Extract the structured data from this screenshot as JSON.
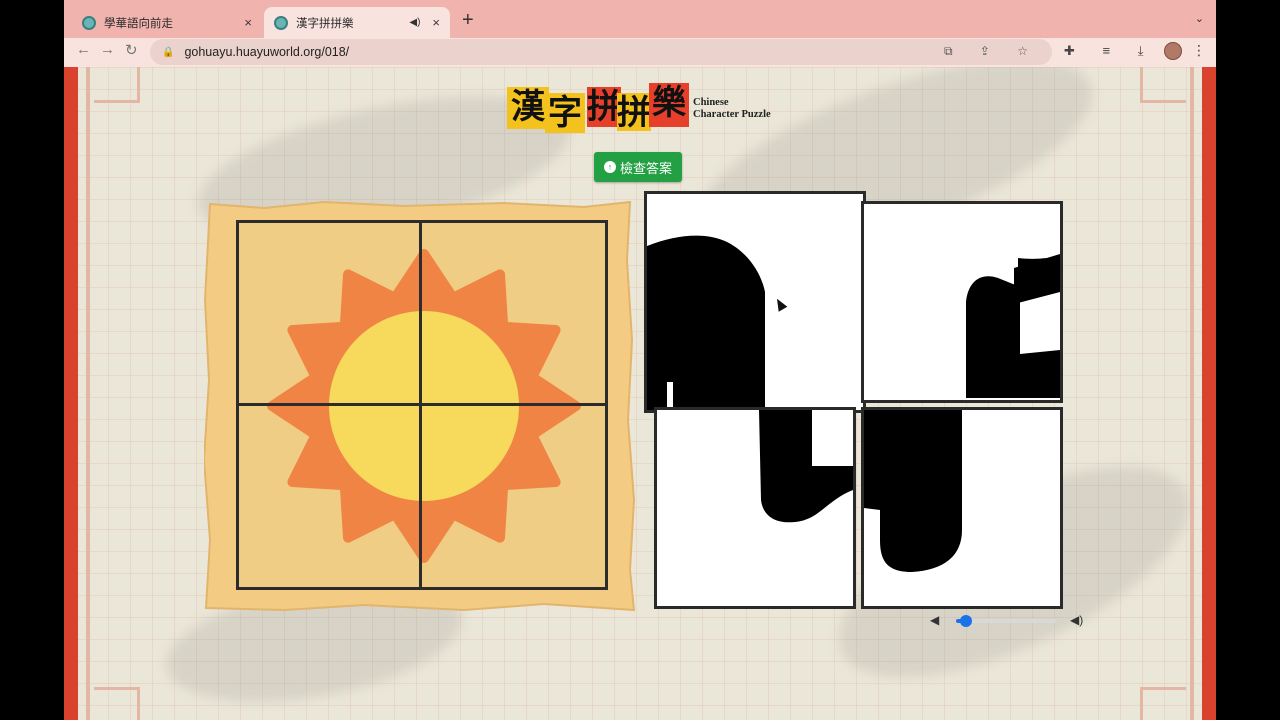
{
  "browser": {
    "tabs": [
      {
        "title": "學華語向前走",
        "active": false,
        "close": "×"
      },
      {
        "title": "漢字拼拼樂",
        "active": true,
        "close": "×",
        "speaker": "◀)"
      }
    ],
    "new_tab": "+",
    "tab_search": "⌄",
    "nav": {
      "back": "←",
      "forward": "→",
      "reload": "↻"
    },
    "url": "gohuayu.huayuworld.org/018/",
    "lock_icon": "🔒",
    "omni_icons": "⧉ ⇪ ☆",
    "ext_icons": "✚ ≡ ⤓ ▯",
    "menu": "⋮"
  },
  "page": {
    "logo": {
      "chars": [
        "漢",
        "字",
        "拼",
        "拼",
        "樂"
      ],
      "colors": [
        "#f4c21c",
        "#f4c21c",
        "#e7402a",
        "#f4c21c",
        "#e7402a"
      ],
      "subtitle_line1": "Chinese",
      "subtitle_line2": "Character Puzzle"
    },
    "check_button": {
      "icon": "↑",
      "label": "檢查答案",
      "color": "#23a043"
    },
    "picture": {
      "subject": "sun",
      "sun_core": "#f7d95c",
      "sun_rays": "#ef8445",
      "parchment": "#f4cb83",
      "cells_fill": "#f0cd84"
    },
    "puzzle_tiles": [
      {
        "id": "top-left"
      },
      {
        "id": "top-right"
      },
      {
        "id": "bottom-left"
      },
      {
        "id": "bottom-right"
      }
    ],
    "volume": {
      "low_icon": "◀",
      "high_icon": "◀)",
      "level": 0.1
    }
  }
}
